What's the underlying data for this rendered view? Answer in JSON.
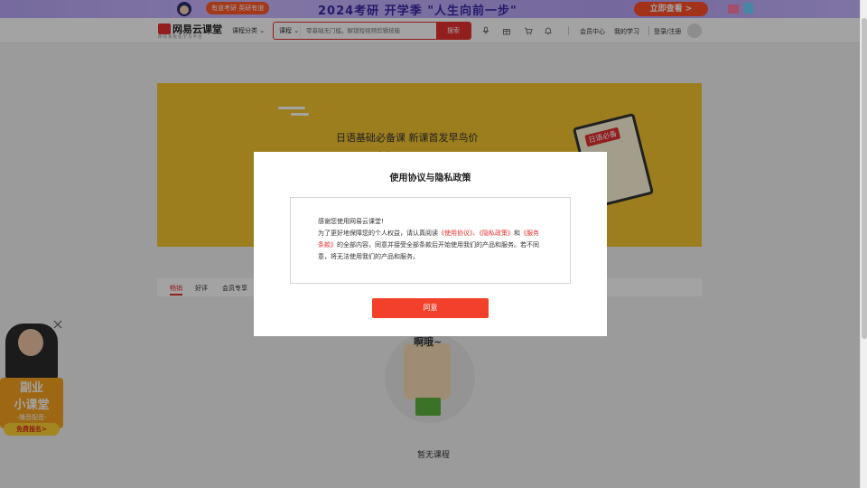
{
  "promo": {
    "tag": "有道考研 英研有道",
    "title": "2024考研 开学季 \"人生向前一步\"",
    "cta": "立即查看 >"
  },
  "header": {
    "logo_text": "网易云课堂",
    "logo_sub": "你的系统化学习平台",
    "category_label": "课程分类",
    "search_scope": "课程",
    "search_placeholder": "零基础无门槛，解锁短视频剪辑技能",
    "search_button": "搜索",
    "member_center": "会员中心",
    "my_learning": "我的学习",
    "login_register": "登录/注册"
  },
  "hero": {
    "subtitle": "日语基础必备课 新课首发早鸟价",
    "title": "开课第一课"
  },
  "tabs": [
    "畅销",
    "好评",
    "会员专享"
  ],
  "empty": {
    "speech": "啊哦~",
    "text": "暂无课程"
  },
  "float_ad": {
    "line1": "副业",
    "line2": "小课堂",
    "line3": "-播音配音-",
    "cta": "免费报名>"
  },
  "modal": {
    "title": "使用协议与隐私政策",
    "greeting": "感谢您使用网易云课堂!",
    "body_prefix": "为了更好地保障您的个人权益，请认真阅读",
    "link_terms": "《使用协议》",
    "sep1": "、",
    "link_privacy": "《隐私政策》",
    "and": "和",
    "link_service": "《服务条款》",
    "body_suffix": "的全部内容，同意并接受全部条款后开始使用我们的产品和服务。若不同意，将无法使用我们的产品和服务。",
    "agree_button": "同意"
  }
}
